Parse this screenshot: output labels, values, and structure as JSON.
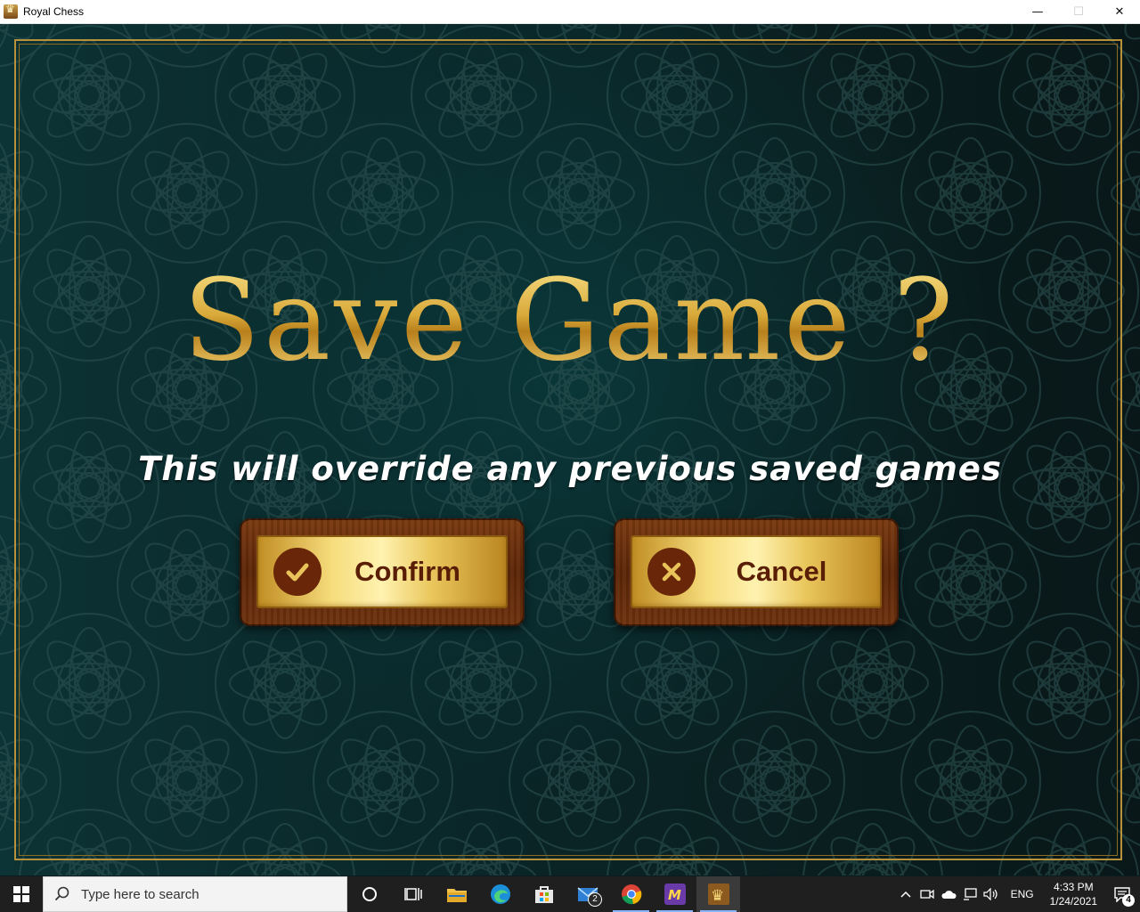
{
  "window": {
    "title": "Royal Chess",
    "minimize": "—",
    "maximize": "☐",
    "close": "✕"
  },
  "dialog": {
    "heading": "Save Game ?",
    "message": "This will override any previous saved games",
    "confirm_label": "Confirm",
    "cancel_label": "Cancel"
  },
  "taskbar": {
    "search_placeholder": "Type here to search",
    "apps": [
      "task-view",
      "file-explorer",
      "edge",
      "microsoft-store",
      "mail",
      "chrome",
      "m-app",
      "royal-chess"
    ],
    "mail_badge": "2",
    "language": "ENG",
    "time": "4:33 PM",
    "date": "1/24/2021",
    "notification_count": "4"
  },
  "colors": {
    "accent_gold": "#d9a93a",
    "button_wood": "#6e320e",
    "background": "#0a2527"
  }
}
